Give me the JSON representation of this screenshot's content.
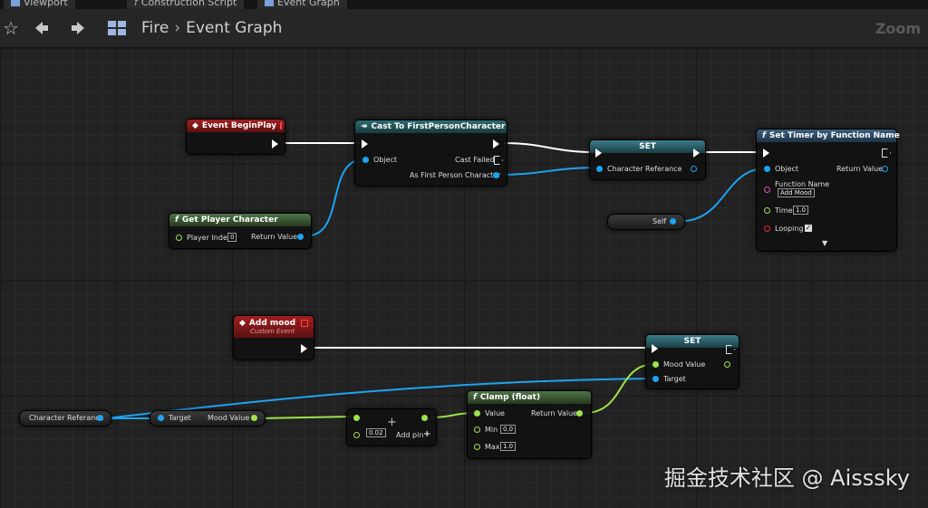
{
  "tabs": [
    {
      "label": "Viewport"
    },
    {
      "label": "Construction Script"
    },
    {
      "label": "Event Graph"
    }
  ],
  "toolbar": {
    "breadcrumb_root": "Fire",
    "breadcrumb_sep": "›",
    "breadcrumb_leaf": "Event Graph",
    "zoom_label": "Zoom"
  },
  "nodes": {
    "begin_play": {
      "title": "Event BeginPlay"
    },
    "cast": {
      "title": "Cast To FirstPersonCharacter",
      "object": "Object",
      "cast_failed": "Cast Failed",
      "as_fpc": "As First Person Character"
    },
    "get_player": {
      "title": "Get Player Character",
      "player_index": "Player Index",
      "player_index_val": "0",
      "return_value": "Return Value"
    },
    "set1": {
      "title": "SET",
      "char_ref": "Character Referance"
    },
    "self": {
      "label": "Self"
    },
    "timer": {
      "title": "Set Timer by Function Name",
      "object": "Object",
      "return_value": "Return Value",
      "function_name": "Function Name",
      "function_name_val": "Add Mood",
      "time": "Time",
      "time_val": "1.0",
      "looping": "Looping",
      "check": "✓"
    },
    "add_mood": {
      "title": "Add mood",
      "subtitle": "Custom Event"
    },
    "set2": {
      "title": "SET",
      "mood_value": "Mood Value",
      "target": "Target"
    },
    "char_ref_var": {
      "label": "Character Referance"
    },
    "getter": {
      "target": "Target",
      "mood_value": "Mood Value"
    },
    "add": {
      "val": "0.02",
      "add_pin": "Add pin"
    },
    "clamp": {
      "title": "Clamp (float)",
      "value": "Value",
      "return_value": "Return Value",
      "min": "Min",
      "min_val": "0.0",
      "max": "Max",
      "max_val": "1.0"
    }
  },
  "watermark": "掘金技术社区 @ Aisssky",
  "colors": {
    "exec": "#ffffff",
    "object_pin": "#1fa3f0",
    "float_pin": "#9fe34a",
    "event_header": "#a31e1e"
  }
}
